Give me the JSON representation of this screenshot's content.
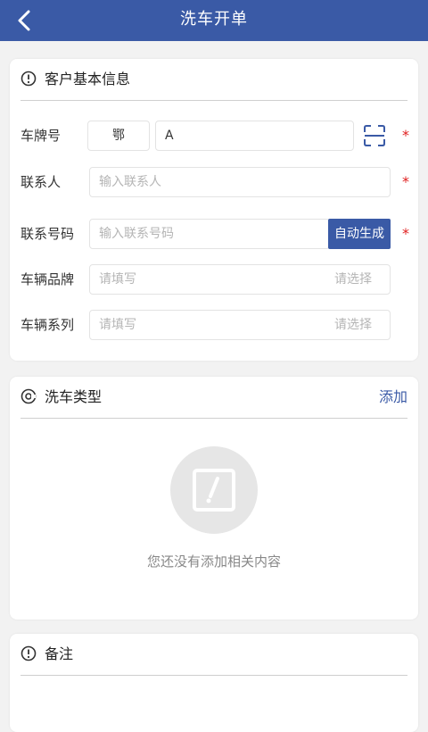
{
  "header": {
    "title": "洗车开单"
  },
  "customer": {
    "title": "客户基本信息",
    "plate_label": "车牌号",
    "plate_province": "鄂",
    "plate_value": "A",
    "contact_label": "联系人",
    "contact_placeholder": "输入联系人",
    "phone_label": "联系号码",
    "phone_placeholder": "输入联系号码",
    "auto_generate": "自动生成",
    "brand_label": "车辆品牌",
    "brand_placeholder": "请填写",
    "brand_select": "请选择",
    "series_label": "车辆系列",
    "series_placeholder": "请填写",
    "series_select": "请选择",
    "required_mark": "*"
  },
  "wash_type": {
    "title": "洗车类型",
    "add_label": "添加",
    "empty_text": "您还没有添加相关内容"
  },
  "remark": {
    "title": "备注"
  },
  "colors": {
    "primary": "#3a5aa6",
    "required": "#e02020"
  }
}
